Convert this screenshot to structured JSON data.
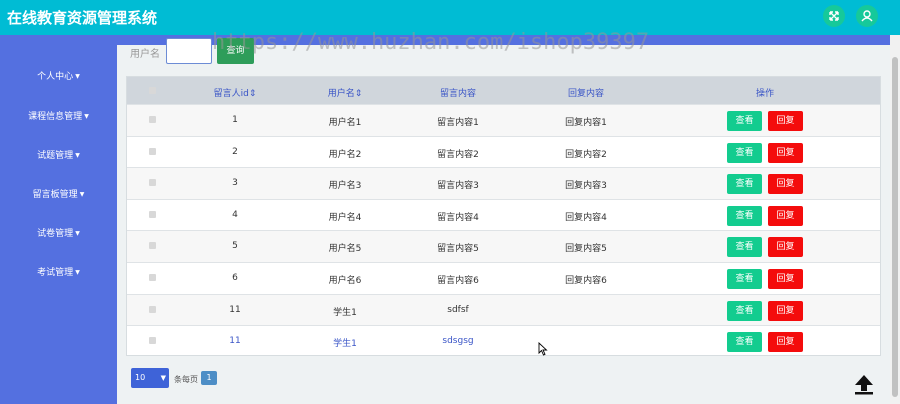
{
  "app": {
    "title": "在线教育资源管理系统"
  },
  "watermark": "https://www.huzhan.com/ishop39397",
  "topbar_icons": [
    "fullscreen-icon",
    "user-icon"
  ],
  "sidebar": {
    "items": [
      {
        "label": "个人中心"
      },
      {
        "label": "课程信息管理"
      },
      {
        "label": "试题管理"
      },
      {
        "label": "留言板管理"
      },
      {
        "label": "试卷管理"
      },
      {
        "label": "考试管理"
      }
    ]
  },
  "search": {
    "label": "用户名",
    "placeholder": "",
    "button": "查询"
  },
  "table": {
    "columns": [
      "留言人id",
      "用户名",
      "留言内容",
      "回复内容",
      "操作"
    ],
    "rows": [
      {
        "id": "1",
        "username": "用户名1",
        "content": "留言内容1",
        "reply": "回复内容1"
      },
      {
        "id": "2",
        "username": "用户名2",
        "content": "留言内容2",
        "reply": "回复内容2"
      },
      {
        "id": "3",
        "username": "用户名3",
        "content": "留言内容3",
        "reply": "回复内容3"
      },
      {
        "id": "4",
        "username": "用户名4",
        "content": "留言内容4",
        "reply": "回复内容4"
      },
      {
        "id": "5",
        "username": "用户名5",
        "content": "留言内容5",
        "reply": "回复内容5"
      },
      {
        "id": "6",
        "username": "用户名6",
        "content": "留言内容6",
        "reply": "回复内容6"
      },
      {
        "id": "11",
        "username": "学生1",
        "content": "sdfsf",
        "reply": ""
      },
      {
        "id": "11",
        "username": "学生1",
        "content": "sdsgsg",
        "reply": ""
      }
    ],
    "view_label": "查看",
    "reply_label": "回复"
  },
  "pager": {
    "page_size": "10",
    "per_page_label": "条每页",
    "current_page": "1"
  },
  "colors": {
    "topbar": "#00bcd4",
    "sidebar": "#5470e0",
    "view": "#13cc8f",
    "reply": "#f40c0c"
  }
}
